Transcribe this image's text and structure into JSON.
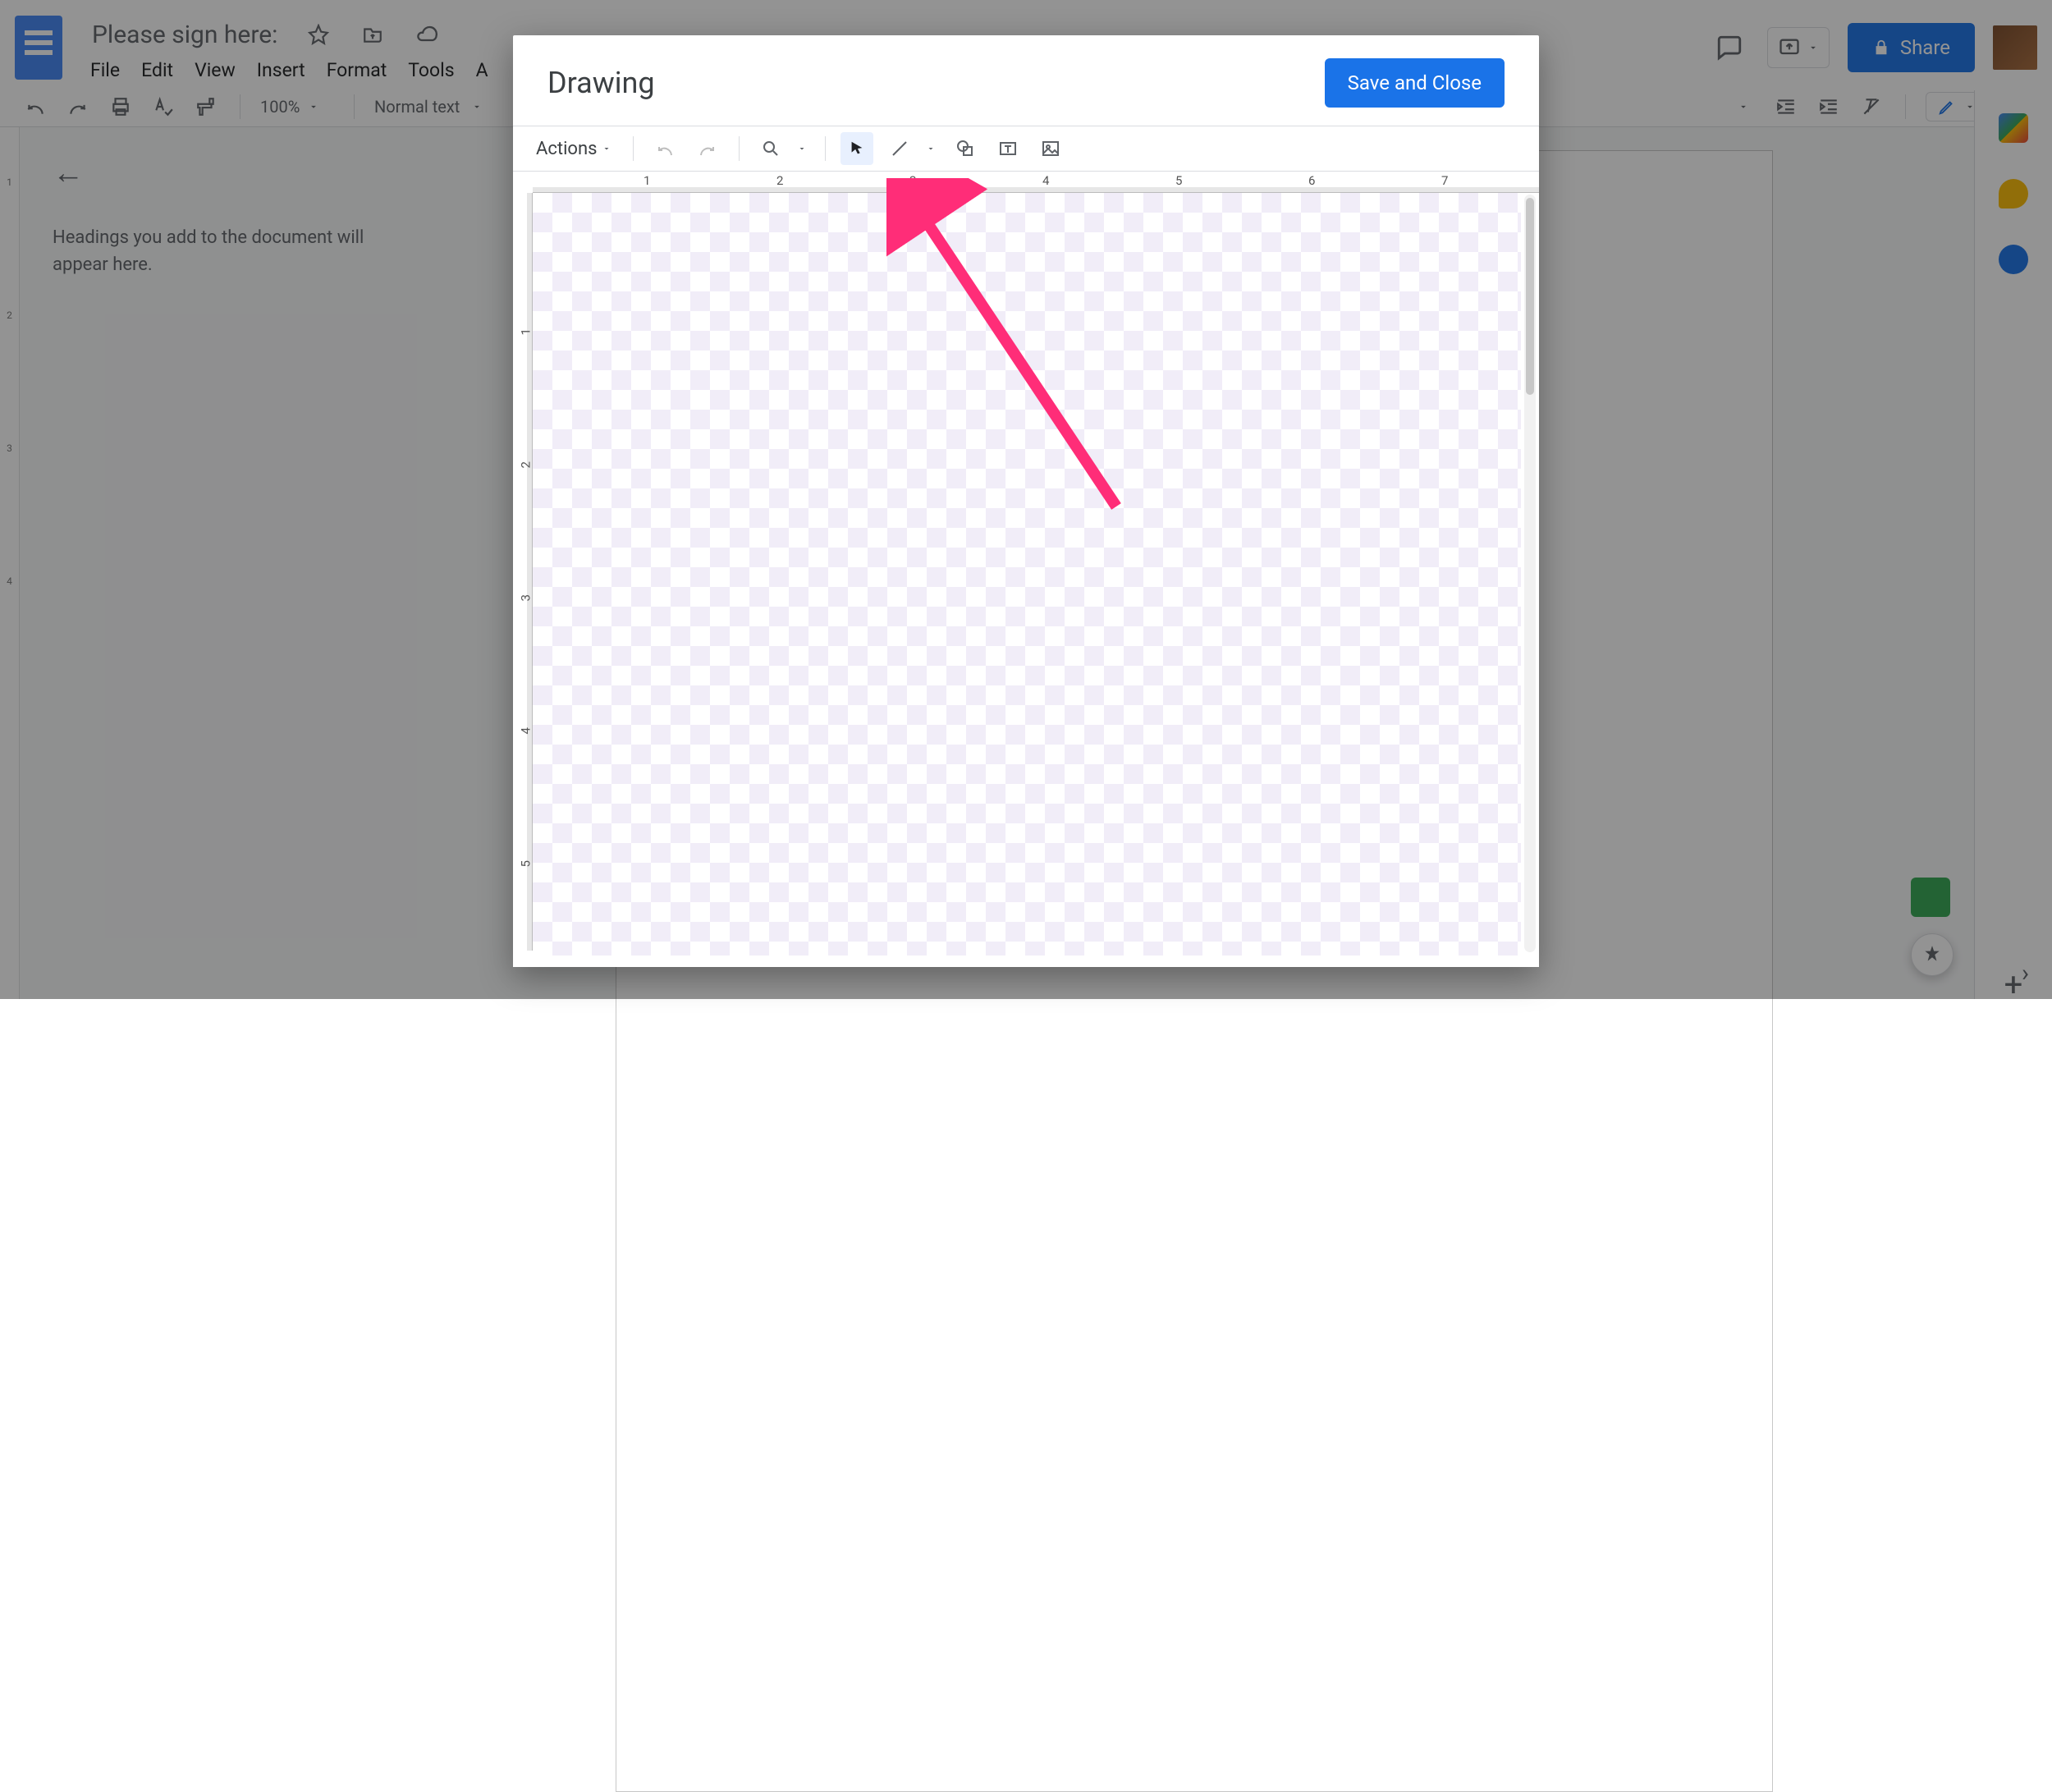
{
  "doc": {
    "title": "Please sign here:",
    "menus": [
      "File",
      "Edit",
      "View",
      "Insert",
      "Format",
      "Tools",
      "A"
    ]
  },
  "toolbar": {
    "zoom": "100%",
    "paragraph_style": "Normal text"
  },
  "share": {
    "label": "Share"
  },
  "outline": {
    "hint": "Headings you add to the document will appear here."
  },
  "doc_ruler": {
    "h_labels": [
      "1"
    ]
  },
  "vruler_labels": [
    "1",
    "2",
    "3",
    "4"
  ],
  "dialog": {
    "title": "Drawing",
    "save_label": "Save and Close",
    "actions_label": "Actions",
    "h_ruler_labels": [
      "1",
      "2",
      "3",
      "4",
      "5",
      "6",
      "7"
    ],
    "v_ruler_labels": [
      "1",
      "2",
      "3",
      "4",
      "5"
    ]
  }
}
